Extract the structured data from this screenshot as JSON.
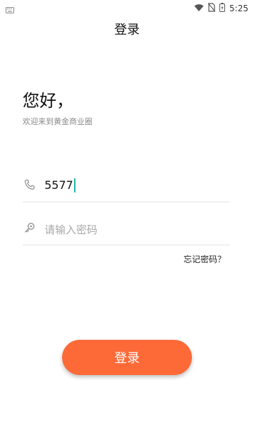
{
  "status_bar": {
    "time": "5:25",
    "icons": [
      "keyboard-icon",
      "wifi-icon",
      "no-sim-icon",
      "battery-icon"
    ]
  },
  "header": {
    "title": "登录"
  },
  "greeting": {
    "title": "您好，",
    "subtitle": "欢迎来到黄金商业圈"
  },
  "form": {
    "phone": {
      "icon": "phone-icon",
      "value": "5577"
    },
    "password": {
      "icon": "key-icon",
      "value": "",
      "placeholder": "请输入密码"
    },
    "forgot_label": "忘记密码？"
  },
  "submit": {
    "label": "登录"
  },
  "colors": {
    "accent": "#fd6a38",
    "caret": "#21b5a8",
    "divider": "#e5e5e5",
    "placeholder": "#a8a8a8"
  }
}
